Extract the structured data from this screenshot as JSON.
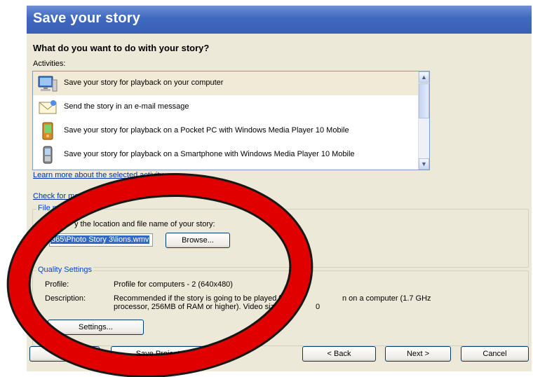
{
  "window": {
    "title": "Save your story"
  },
  "main": {
    "question": "What do you want to do with your story?",
    "activities_label": "Activities:",
    "activities": [
      {
        "label": "Save your story for playback on your computer",
        "icon": "computer-icon",
        "selected": true
      },
      {
        "label": "Send the story in an e-mail message",
        "icon": "email-icon",
        "selected": false
      },
      {
        "label": "Save your story for playback on a Pocket PC with Windows Media Player 10 Mobile",
        "icon": "pocket-pc-icon",
        "selected": false
      },
      {
        "label": "Save your story for playback on a Smartphone with Windows Media Player 10 Mobile",
        "icon": "smartphone-icon",
        "selected": false
      }
    ],
    "learn_more_link": "Learn more about the selected activity",
    "check_more_link_start": "Check for more st",
    "check_more_link_end": "te"
  },
  "file_group": {
    "legend": "File na",
    "instruction": "y the location and file name of your story:",
    "filename_value": "365\\Photo Story 3\\lions.wmv",
    "browse_label": "Browse..."
  },
  "quality": {
    "legend": "Quality Settings",
    "profile_label": "Profile:",
    "profile_value": "Profile for computers - 2 (640x480)",
    "description_label": "Description:",
    "description_line1_a": "Recommended if the story is going to be played full s",
    "description_line1_b": "n on a computer (1.7 GHz",
    "description_line2_a": "processor, 256MB of RAM or higher). Video size: 64",
    "description_line2_b": "0",
    "settings_label": "Settings..."
  },
  "footer": {
    "save_project_label": "Save Project...",
    "back_label": "< Back",
    "next_label": "Next >",
    "cancel_label": "Cancel"
  },
  "colors": {
    "titlebar": "#3f68c0",
    "overlay_circle": "#e00000",
    "selection": "#f0ead6"
  }
}
